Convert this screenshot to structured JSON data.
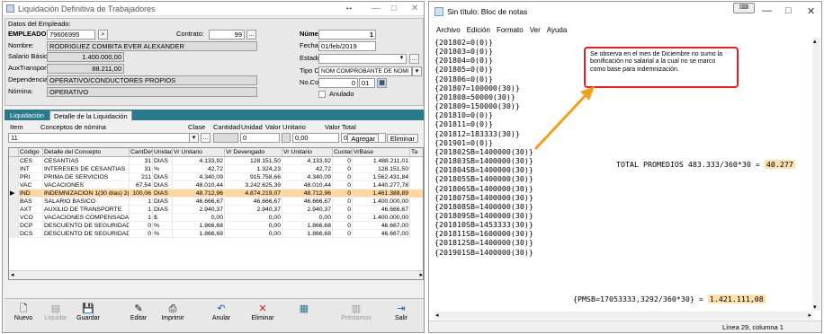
{
  "left_window": {
    "title": "Liquidación Definitiva de Trabajadores",
    "arrows": "↔",
    "header": {
      "section_label": "Datos del Empleado:",
      "empleado_label": "EMPLEADO:",
      "empleado_value": "79606995",
      "contrato_label": "Contrato:",
      "contrato_value": "99",
      "nombre_label": "Nombre:",
      "nombre_value": "RODRIGUEZ COMBITA EVER ALEXANDER",
      "salario_label": "Salario Básico:",
      "salario_value": "1.400.000,00",
      "aux_label": "AuxTransporte:",
      "aux_value": "88.211,00",
      "dep_label": "Dependencia:",
      "dep_value": "OPERATIVO/CONDUCTORES PROPIOS",
      "nomina_label": "Nómina:",
      "nomina_value": "OPERATIVO",
      "numero_label": "Número:",
      "numero_value": "1",
      "fecha_label": "Fecha:",
      "fecha_value": "01/feb/2019",
      "estado_label": "Estado:",
      "estado_value": "",
      "tipo_label": "Tipo Comp:",
      "tipo_value": "NOM  COMPROBANTE DE NOMI",
      "nocomp_label": "No.Comp:",
      "nocomp_a": "0",
      "nocomp_b": "01",
      "anulado_label": "Anulado"
    },
    "tabs": [
      "Liquidación",
      "Detalle de la Liquidación"
    ],
    "item_headers": [
      "Item",
      "Conceptos de nómina",
      "Clase",
      "Cantidad",
      "Unidad",
      "Valor Unitario",
      "Valor Total"
    ],
    "item_row": {
      "item": "11",
      "cantidad": "0",
      "unitario": "0,00",
      "total": "0,00"
    },
    "agregar": "Agregar",
    "eliminar_small": "Eliminar",
    "grid_headers": [
      "Código",
      "Detalle del Concepto",
      "CantDev",
      "Unidad",
      "Vr Unitario",
      "Vr Devengado",
      "Vr Unitario",
      "Cuotas",
      "VrBase",
      "Ta"
    ],
    "rows": [
      [
        "CES",
        "CESANTIAS",
        "31",
        "DIAS",
        "4.133,92",
        "128.151,50",
        "4.133,92",
        "0",
        "1.488.211,01"
      ],
      [
        "INT",
        "INTERESES DE CESANTIAS",
        "31",
        "%",
        "42,72",
        "1.324,23",
        "42,72",
        "0",
        "128.151,50"
      ],
      [
        "PRI",
        "PRIMA DE SERVICIOS",
        "211",
        "DIAS",
        "4.340,09",
        "915.758,66",
        "4.340,09",
        "0",
        "1.562.431,84"
      ],
      [
        "VAC",
        "VACACIONES",
        "67,54",
        "DIAS",
        "48.010,44",
        "3.242.625,39",
        "48.010,44",
        "0",
        "1.440.277,78"
      ],
      [
        "IND",
        "INDEMNIZACION 1(30 días) 2(20",
        "100,06",
        "DIAS",
        "48.712,96",
        "4.874.219,07",
        "48.712,96",
        "0",
        "1.461.388,89"
      ],
      [
        "BAS",
        "SALARIO BASICO",
        "1",
        "DIAS",
        "46.666,67",
        "46.666,67",
        "46.666,67",
        "0",
        "1.400.000,00"
      ],
      [
        "AXT",
        "AUXILIO DE TRANSPORTE",
        "1",
        "DIAS",
        "2.940,37",
        "2.940,37",
        "2.940,37",
        "0",
        "46.666,67"
      ],
      [
        "VCO",
        "VACACIONES COMPENSADAS",
        "1",
        "$",
        "0,00",
        "0,00",
        "0,00",
        "0",
        "1.400.000,00"
      ],
      [
        "DCP",
        "DESCUENTO DE SEGURIDAD SO",
        "0",
        "%",
        "1.866,68",
        "0,00",
        "1.866,68",
        "0",
        "46.667,00"
      ],
      [
        "DCS",
        "DESCUENTO DE SEGURIDAD SO",
        "0",
        "%",
        "1.866,68",
        "0,00",
        "1.866,68",
        "0",
        "46.667,00"
      ]
    ],
    "buttons": [
      "Nuevo",
      "Liquidar",
      "Guardar",
      "Editar",
      "Imprimir",
      "Anular",
      "Eliminar",
      "",
      "Préstamos",
      "Salir"
    ]
  },
  "right_window": {
    "title": "Sin título: Bloc de notas",
    "menu": [
      "Archivo",
      "Edición",
      "Formato",
      "Ver",
      "Ayuda"
    ],
    "lines": [
      "{201802=0(0)}",
      "{201803=0(0)}",
      "{201804=0(0)}",
      "{201805=0(0)}",
      "{201806=0(0)}",
      "{201807=100000(30)}",
      "{201808=50000(30)}",
      "{201809=150000(30)}",
      "{201810=0(0)}",
      "{201811=0(0)}",
      "{201812=183333(30)}",
      "{201901=0(0)}",
      "{201802SB=1400000(30)}",
      "{201803SB=1400000(30)}",
      "{201804SB=1400000(30)}",
      "{201805SB=1400000(30)}",
      "{201806SB=1400000(30)}",
      "{201807SB=1400000(30)}",
      "{201808SB=1400000(30)}",
      "{201809SB=1400000(30)}",
      "{201810SB=1453333(30)}",
      "{201811SB=1600000(30)}",
      "{201812SB=1400000(30)}",
      "{201901SB=1400000(30)}"
    ],
    "note": "Se observa en el mes de Diciembre no sumo la bonificación no salarial a la cual no se marco como base para indemnización.",
    "total_text": "TOTAL PROMEDIOS 483.333/360*30 =",
    "total_value": "40.277",
    "pmsb_text": "{PMSB=17053333,3292/360*30}  =",
    "pmsb_value": "1.421.111,08",
    "status": "Línea 29, columna 1"
  },
  "colors": {
    "accent": "#2a7a8a",
    "highlight": "#fdd6a0",
    "note_border": "#dd2222",
    "arrow": "#f0a020"
  }
}
